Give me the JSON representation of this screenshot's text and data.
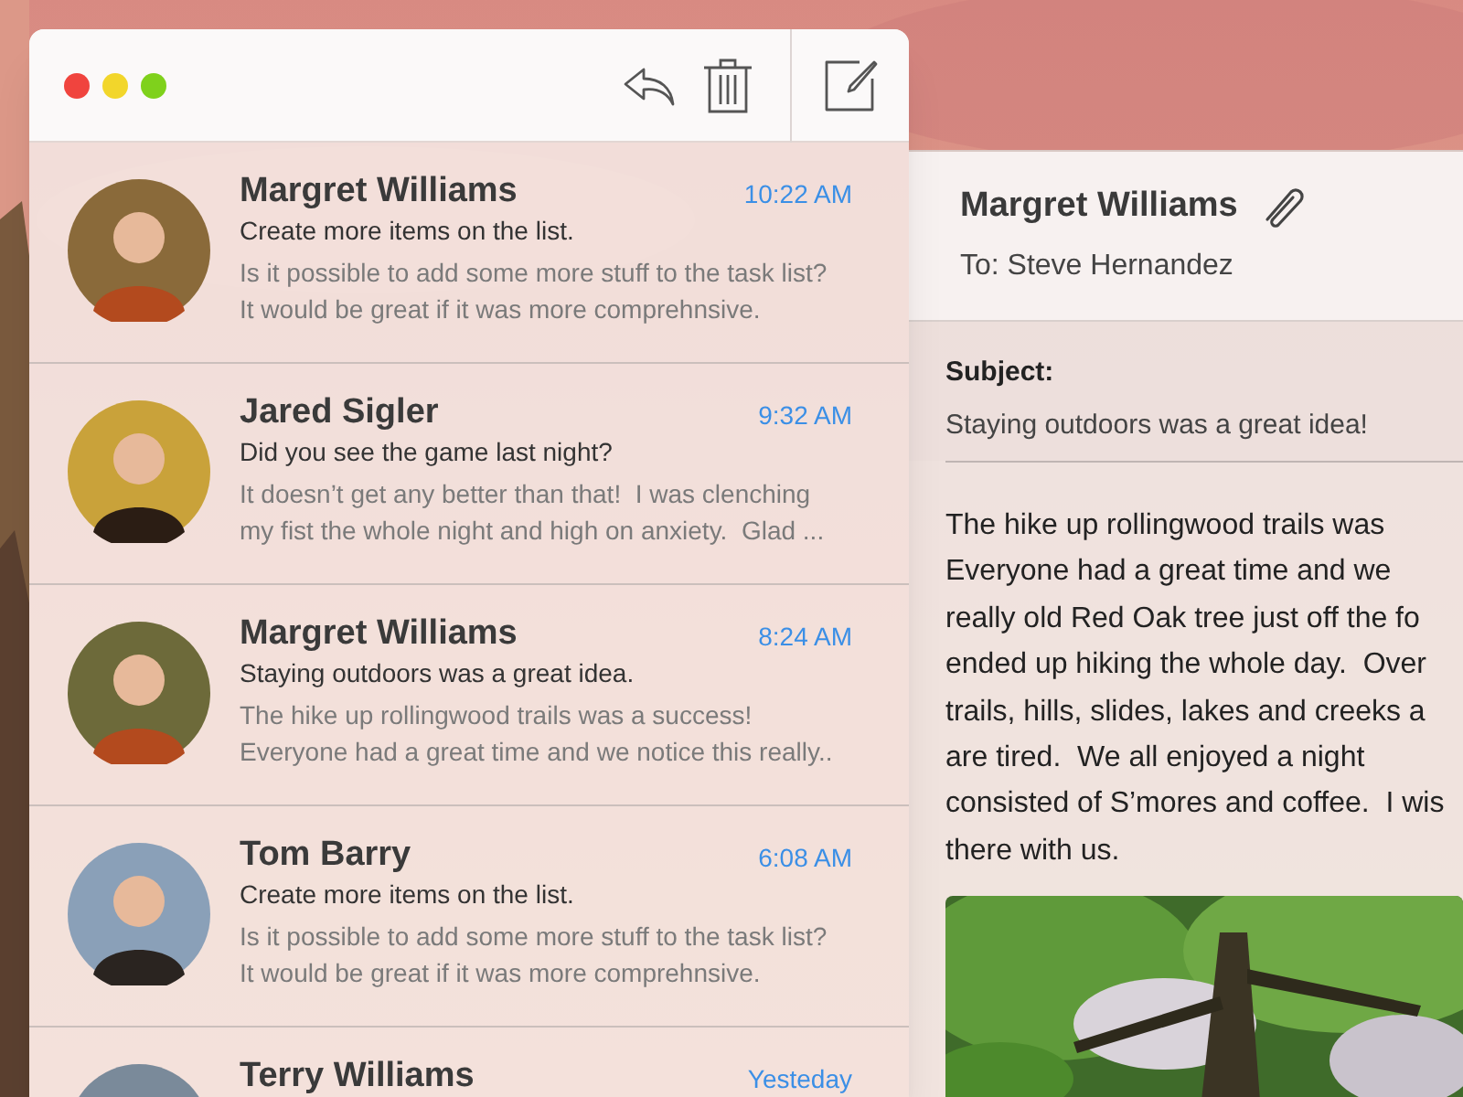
{
  "window": {
    "traffic_lights": [
      {
        "color": "#f0443e"
      },
      {
        "color": "#f2d62b"
      },
      {
        "color": "#7fd11c"
      }
    ]
  },
  "messages": [
    {
      "sender": "Margret Williams",
      "time": "10:22 AM",
      "subject": "Create more items on the list.",
      "preview": "Is it possible to add some more stuff to the task list?  It would be great if it was more comprehnsive."
    },
    {
      "sender": "Jared Sigler",
      "time": "9:32 AM",
      "subject": "Did you see the game last night?",
      "preview": "It doesn’t get any better than that!  I was clenching my fist the whole night and high on anxiety.  Glad ..."
    },
    {
      "sender": "Margret Williams",
      "time": "8:24 AM",
      "subject": "Staying outdoors was a great idea.",
      "preview": "The hike up rollingwood trails was a success! Everyone had a great time and we notice this really.."
    },
    {
      "sender": "Tom Barry",
      "time": "6:08 AM",
      "subject": "Create more items on the list.",
      "preview": "Is it possible to add some more stuff to the task list?  It would be great if it was more comprehnsive."
    },
    {
      "sender": "Terry Williams",
      "time": "Yesteday"
    }
  ],
  "reading_pane": {
    "sender": "Margret Williams",
    "to": "To: Steve Hernandez",
    "subject_label": "Subject:",
    "subject": "Staying outdoors was a great idea!",
    "body_lines": [
      "The hike up rollingwood trails was",
      "Everyone had a great time and we",
      "really old Red Oak tree just off the fo",
      "ended up hiking the whole day.  Over",
      "trails, hills, slides, lakes and creeks a",
      "are tired.  We all enjoyed a night",
      "consisted of S’mores and coffee.  I wis",
      "there with us."
    ]
  }
}
